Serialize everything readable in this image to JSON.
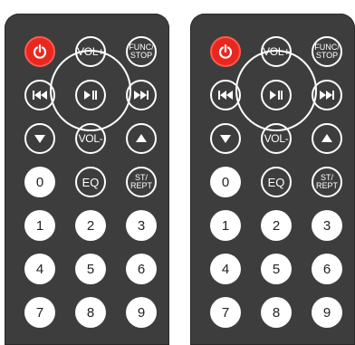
{
  "remotes": [
    {
      "buttons": {
        "vol_up": "VOL+",
        "func_stop": "FUNC/\nSTOP",
        "vol_down": "VOL-",
        "eq": "EQ",
        "st_rept": "ST/\nREPT",
        "digits": [
          "0",
          "1",
          "2",
          "3",
          "4",
          "5",
          "6",
          "7",
          "8",
          "9"
        ]
      }
    },
    {
      "buttons": {
        "vol_up": "VOL+",
        "func_stop": "FUNC/\nSTOP",
        "vol_down": "VOL-",
        "eq": "EQ",
        "st_rept": "ST/\nREPT",
        "digits": [
          "0",
          "1",
          "2",
          "3",
          "4",
          "5",
          "6",
          "7",
          "8",
          "9"
        ]
      }
    }
  ],
  "colors": {
    "body": "#3d3d3d",
    "power": "#e8281f",
    "button_outline": "#ffffff",
    "digit_button": "#ffffff"
  },
  "icons": [
    "power-icon",
    "previous-track-icon",
    "play-pause-icon",
    "next-track-icon",
    "down-arrow-icon",
    "up-arrow-icon"
  ]
}
